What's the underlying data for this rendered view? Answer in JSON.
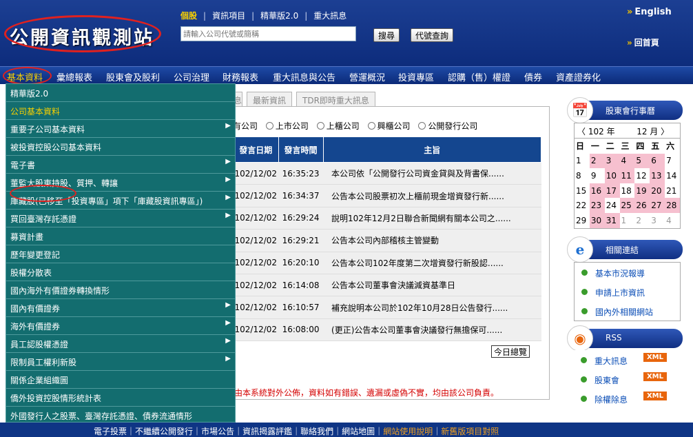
{
  "header": {
    "logo": "公開資訊觀測站",
    "links": [
      "個股",
      "資訊項目",
      "精華版2.0",
      "重大訊息"
    ],
    "search_placeholder": "請輸入公司代號或簡稱",
    "search_button": "搜尋",
    "code_button": "代號查詢",
    "english": "English",
    "home": "回首頁"
  },
  "menubar": [
    "基本資料",
    "彙總報表",
    "股東會及股利",
    "公司治理",
    "財務報表",
    "重大訊息與公告",
    "營運概況",
    "投資專區",
    "認購（售）權證",
    "債券",
    "資產證券化"
  ],
  "dropdown": [
    {
      "label": "精華版2.0",
      "arrow": false
    },
    {
      "label": "公司基本資料",
      "arrow": false
    },
    {
      "label": "重要子公司基本資料",
      "arrow": true
    },
    {
      "label": "被投資控股公司基本資料",
      "arrow": false
    },
    {
      "label": "電子書",
      "arrow": true
    },
    {
      "label": "董監大股東持股、質押、轉讓",
      "arrow": true
    },
    {
      "label": "庫藏股(已移至「投資專區」項下「庫藏股資訊專區」)",
      "arrow": true
    },
    {
      "label": "買回臺灣存託憑證",
      "arrow": true
    },
    {
      "label": "募資計畫",
      "arrow": false
    },
    {
      "label": "歷年變更登記",
      "arrow": false
    },
    {
      "label": "股權分散表",
      "arrow": false
    },
    {
      "label": "國內海外有價證券轉換情形",
      "arrow": false
    },
    {
      "label": "國內有價證券",
      "arrow": true
    },
    {
      "label": "海外有價證券",
      "arrow": true
    },
    {
      "label": "員工認股權憑證",
      "arrow": true
    },
    {
      "label": "限制員工權利新股",
      "arrow": true
    },
    {
      "label": "關係企業組織圖",
      "arrow": false
    },
    {
      "label": "僑外投資控股情形統計表",
      "arrow": false
    },
    {
      "label": "外國發行人之股票、臺灣存託憑證、債券流通情形",
      "arrow": false
    }
  ],
  "tabs": [
    "息",
    "最新資訊",
    "TDR即時重大訊息"
  ],
  "radios": [
    "有公司",
    "上市公司",
    "上櫃公司",
    "興櫃公司",
    "公開發行公司"
  ],
  "table": {
    "headers": [
      "發言日期",
      "發言時間",
      "主旨"
    ],
    "rows": [
      [
        "102/12/02",
        "16:35:23",
        "本公司依「公開發行公司資金貸與及背書保......"
      ],
      [
        "102/12/02",
        "16:34:37",
        "公告本公司股票初次上櫃前現金增資發行新......"
      ],
      [
        "102/12/02",
        "16:29:24",
        "說明102年12月2日聯合新聞網有關本公司之......"
      ],
      [
        "102/12/02",
        "16:29:21",
        "公告本公司內部稽核主管變動"
      ],
      [
        "102/12/02",
        "16:20:10",
        "公告本公司102年度第二次增資發行新股認......"
      ],
      [
        "102/12/02",
        "16:14:08",
        "公告本公司董事會決議減資基準日"
      ],
      [
        "102/12/02",
        "16:10:57",
        "補充說明本公司於102年10月28日公告發行......"
      ],
      [
        "102/12/02",
        "16:08:00",
        "(更正)公告本公司董事會決議發行無擔保可......"
      ]
    ]
  },
  "today_button": "今日總覽",
  "notice": "由本系統對外公佈，資料如有錯誤、遺漏或虛偽不實，均由該公司負責。",
  "calendar": {
    "title": "股東會行事曆",
    "year": "102 年",
    "month": "12 月",
    "weekdays": [
      "日",
      "一",
      "二",
      "三",
      "四",
      "五",
      "六"
    ],
    "weeks": [
      [
        [
          "1",
          0
        ],
        [
          "2",
          1
        ],
        [
          "3",
          1
        ],
        [
          "4",
          1
        ],
        [
          "5",
          1
        ],
        [
          "6",
          1
        ],
        [
          "7",
          0
        ]
      ],
      [
        [
          "8",
          0
        ],
        [
          "9",
          0
        ],
        [
          "10",
          1
        ],
        [
          "11",
          1
        ],
        [
          "12",
          0
        ],
        [
          "13",
          1
        ],
        [
          "14",
          0
        ]
      ],
      [
        [
          "15",
          0
        ],
        [
          "16",
          1
        ],
        [
          "17",
          1
        ],
        [
          "18",
          0
        ],
        [
          "19",
          1
        ],
        [
          "20",
          1
        ],
        [
          "21",
          0
        ]
      ],
      [
        [
          "22",
          0
        ],
        [
          "23",
          1
        ],
        [
          "24",
          0
        ],
        [
          "25",
          1
        ],
        [
          "26",
          1
        ],
        [
          "27",
          1
        ],
        [
          "28",
          1
        ]
      ],
      [
        [
          "29",
          0
        ],
        [
          "30",
          1
        ],
        [
          "31",
          1
        ],
        [
          "1",
          2
        ],
        [
          "2",
          2
        ],
        [
          "3",
          2
        ],
        [
          "4",
          2
        ]
      ]
    ]
  },
  "related": {
    "title": "相關連結",
    "items": [
      "基本市況報導",
      "申請上市資訊",
      "國內外相關網站"
    ]
  },
  "rss": {
    "title": "RSS",
    "items": [
      "重大訊息",
      "股東會",
      "除權除息"
    ],
    "badge": "XML"
  },
  "footer": [
    "電子投票",
    "不繼續公開發行",
    "市場公告",
    "資訊揭露評鑑",
    "聯絡我們",
    "網站地圖",
    "網站使用說明",
    "新舊版項目對照"
  ]
}
